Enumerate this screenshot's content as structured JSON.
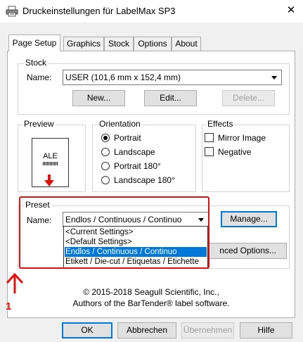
{
  "window": {
    "title": "Druckeinstellungen für LabelMax SP3",
    "close_glyph": "✕"
  },
  "tabs": [
    {
      "label": "Page Setup",
      "active": true
    },
    {
      "label": "Graphics"
    },
    {
      "label": "Stock"
    },
    {
      "label": "Options"
    },
    {
      "label": "About"
    }
  ],
  "stock": {
    "group_label": "Stock",
    "name_label": "Name:",
    "name_value": "USER (101,6 mm x 152,4 mm)",
    "new_button": "New...",
    "edit_button": "Edit...",
    "delete_button": "Delete..."
  },
  "preview": {
    "group_label": "Preview",
    "label_text": "ALE"
  },
  "orientation": {
    "group_label": "Orientation",
    "options": [
      {
        "label": "Portrait",
        "selected": true
      },
      {
        "label": "Landscape",
        "selected": false
      },
      {
        "label": "Portrait 180°",
        "selected": false
      },
      {
        "label": "Landscape 180°",
        "selected": false
      }
    ]
  },
  "effects": {
    "group_label": "Effects",
    "options": [
      {
        "label": "Mirror Image",
        "checked": false
      },
      {
        "label": "Negative",
        "checked": false
      }
    ]
  },
  "preset": {
    "group_label": "Preset",
    "name_label": "Name:",
    "name_value": "Endlos / Continuous / Continuo",
    "manage_button": "Manage...",
    "advanced_button_partial": "nced Options...",
    "dropdown_items": [
      {
        "label": "<Current Settings>",
        "selected": false
      },
      {
        "label": "<Default Settings>",
        "selected": false
      },
      {
        "label": "Endlos / Continuous / Continuo",
        "selected": true
      },
      {
        "label": "Etikett / Die-cut / Etiquetas / Etichette",
        "selected": false
      }
    ]
  },
  "annotation": {
    "marker_number": "1",
    "color": "#e01010"
  },
  "copyright": {
    "line1": "© 2015-2018 Seagull Scientific, Inc.,",
    "line2": "Authors of the BarTender® label software."
  },
  "footer": {
    "ok": "OK",
    "cancel": "Abbrechen",
    "apply": "Übernehmen",
    "help": "Hilfe"
  },
  "colors": {
    "accent": "#0078d7",
    "annotation_red": "#e01010"
  }
}
